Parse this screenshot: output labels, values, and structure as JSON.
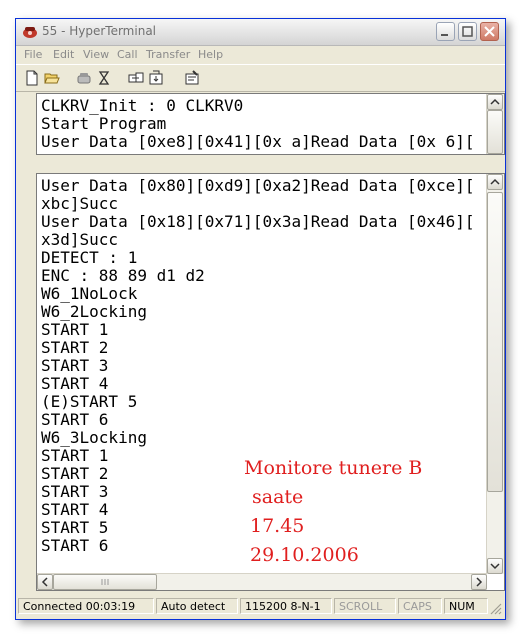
{
  "window": {
    "title": "55 - HyperTerminal"
  },
  "menu": [
    "File",
    "Edit",
    "View",
    "Call",
    "Transfer",
    "Help"
  ],
  "toolbar": {
    "buttons": [
      "new-icon",
      "open-icon",
      "phone-icon",
      "disconnect-icon",
      "send-icon",
      "properties-icon"
    ]
  },
  "top_pane": {
    "lines": [
      "CLKRV_Init : 0 CLKRV0",
      "Start Program",
      "User Data [0xe8][0x41][0x a]Read Data [0x 6]["
    ]
  },
  "main_pane": {
    "lines": [
      "User Data [0x80][0xd9][0xa2]Read Data [0xce][",
      "xbc]Succ",
      "User Data [0x18][0x71][0x3a]Read Data [0x46][",
      "x3d]Succ",
      "DETECT : 1",
      "ENC : 88 89 d1 d2",
      "W6_1NoLock",
      "W6_2Locking",
      "START 1",
      "START 2",
      "START 3",
      "START 4",
      "(E)START 5",
      "START 6",
      "W6_3Locking",
      "START 1",
      "START 2",
      "START 3",
      "START 4",
      "START 5",
      "START 6"
    ]
  },
  "annotation": {
    "lines": [
      "Monitore tunere B",
      "saate",
      "17.45",
      "29.10.2006"
    ],
    "color": "#e01f1f"
  },
  "statusbar": {
    "connected": "Connected 00:03:19",
    "detect": "Auto detect",
    "settings": "115200 8-N-1",
    "scroll": "SCROLL",
    "caps": "CAPS",
    "num": "NUM"
  }
}
